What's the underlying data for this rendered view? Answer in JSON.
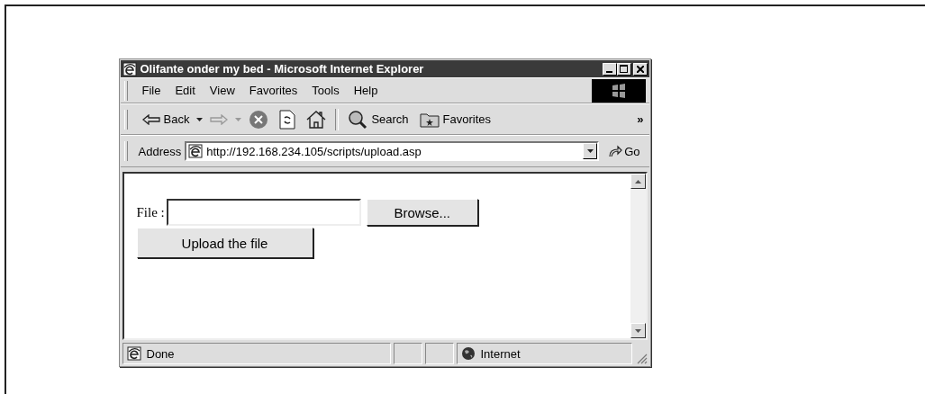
{
  "window": {
    "title": "Olifante onder my bed - Microsoft Internet Explorer"
  },
  "menu": [
    "File",
    "Edit",
    "View",
    "Favorites",
    "Tools",
    "Help"
  ],
  "toolbar": [
    {
      "kind": "back",
      "label": "Back",
      "disabled": false
    },
    {
      "kind": "forward",
      "disabled": true
    },
    {
      "kind": "stop",
      "disabled": false
    },
    {
      "kind": "refresh",
      "disabled": false
    },
    {
      "kind": "home",
      "disabled": false
    },
    {
      "kind": "separator"
    },
    {
      "kind": "search",
      "label": "Search",
      "disabled": false
    },
    {
      "kind": "favorites",
      "label": "Favorites",
      "disabled": false
    }
  ],
  "toolbar_more": "»",
  "address": {
    "label": "Address",
    "value": "http://192.168.234.105/scripts/upload.asp",
    "go": "Go"
  },
  "page": {
    "file_label": "File :",
    "browse": "Browse...",
    "upload": "Upload the file"
  },
  "status_bar": {
    "text": "Done",
    "zone": "Internet"
  }
}
